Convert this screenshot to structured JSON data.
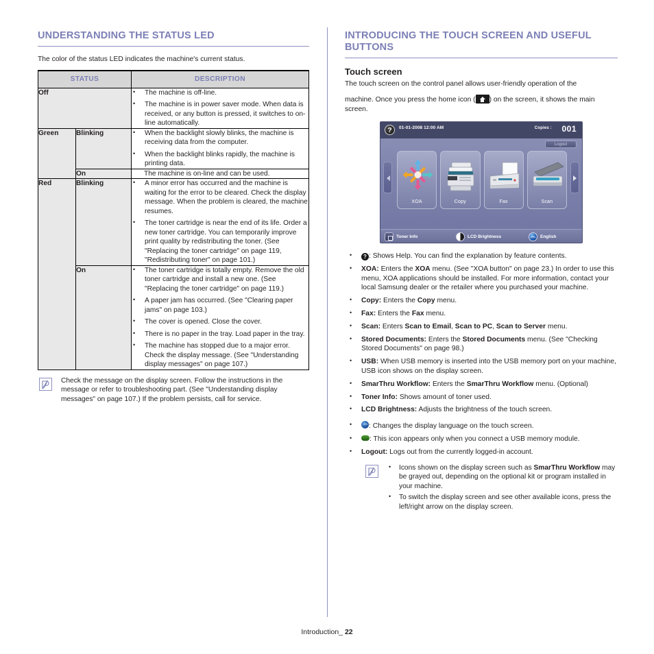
{
  "left": {
    "heading": "UNDERSTANDING THE STATUS LED",
    "intro": "The color of the status LED indicates the machine's current status.",
    "table": {
      "headers": {
        "status": "STATUS",
        "description": "DESCRIPTION"
      },
      "rows": [
        {
          "color": "Off",
          "state": "",
          "items": [
            "The machine is off-line.",
            "The machine is in power saver mode. When data is received, or any button is pressed, it switches to on-line automatically."
          ]
        },
        {
          "color": "Green",
          "state": "Blinking",
          "items": [
            "When the backlight slowly blinks, the machine is receiving data from the computer.",
            "When the backlight blinks rapidly, the machine is printing data."
          ]
        },
        {
          "color": "",
          "state": "On",
          "plain": "The machine is on-line and can be used."
        },
        {
          "color": "Red",
          "state": "Blinking",
          "items": [
            "A minor error has occurred and the machine is waiting for the error to be cleared. Check the display message. When the problem is cleared, the machine resumes.",
            "The toner cartridge is near the end of its life. Order a new toner cartridge. You can temporarily improve print quality by redistributing the toner. (See \"Replacing the toner cartridge\" on page 119, \"Redistributing toner\" on page 101.)"
          ]
        },
        {
          "color": "",
          "state": "On",
          "items": [
            "The toner cartridge is totally empty. Remove the old toner cartridge and install a new one. (See \"Replacing the toner cartridge\" on page 119.)",
            "A paper jam has occurred. (See \"Clearing paper jams\" on page 103.)",
            "The cover is opened. Close the cover.",
            "There is no paper in the tray. Load paper in the tray.",
            "The machine has stopped due to a major error. Check the display message. (See \"Understanding display messages\" on page 107.)"
          ]
        }
      ]
    },
    "note": "Check the message on the display screen. Follow the instructions in the message or refer to troubleshooting part. (See \"Understanding display messages\" on page 107.) If the problem persists, call for service."
  },
  "right": {
    "heading": "INTRODUCING THE TOUCH SCREEN AND USEFUL BUTTONS",
    "sub_heading": "Touch screen",
    "intro_part1": "The touch screen on the control panel allows user-friendly operation of the",
    "intro_part2_pre": "machine. Once you press the home icon (",
    "intro_part2_post": ") on the screen, it shows the main screen.",
    "screen": {
      "datetime": "01-01-2008 12:00 AM",
      "copies_label": "Copies :",
      "copies_value": "001",
      "logout": "Logout",
      "help_glyph": "?",
      "tiles": [
        {
          "label": "XOA",
          "icon": "xoa-icon"
        },
        {
          "label": "Copy",
          "icon": "copy-machine-icon"
        },
        {
          "label": "Fax",
          "icon": "fax-machine-icon"
        },
        {
          "label": "Scan",
          "icon": "scanner-icon"
        }
      ],
      "bottom_bar": [
        {
          "label": "Toner Info",
          "icon": "toner-info-icon"
        },
        {
          "label": "LCD Brightness",
          "icon": "brightness-icon"
        },
        {
          "label": "English",
          "icon": "language-globe-icon"
        }
      ]
    },
    "bullets": [
      {
        "icon": "help-icon",
        "text": ": Shows Help. You can find the explanation by feature contents."
      },
      {
        "term": "XOA:",
        "text": " Enters the |XOA| menu. (See \"XOA button\" on page 23.) In order to use this menu, XOA applications should be installed. For more information, contact your local Samsung dealer or the retailer where you purchased your machine."
      },
      {
        "term": "Copy:",
        "text": " Enters the |Copy| menu."
      },
      {
        "term": "Fax:",
        "text": " Enters the |Fax| menu."
      },
      {
        "term": "Scan:",
        "text": " Enters |Scan to Email|, |Scan to PC|, |Scan to Server| menu."
      },
      {
        "term": "Stored Documents:",
        "text": " Enters the |Stored Documents| menu. (See \"Checking Stored Documents\" on page 98.)"
      },
      {
        "term": "USB:",
        "text": " When USB memory is inserted into the USB memory port on your machine, USB icon shows on the display screen."
      },
      {
        "term": "SmarThru Workflow:",
        "text": " Enters the |SmarThru Workflow| menu. (Optional)"
      },
      {
        "term": "Toner Info:",
        "text": " Shows amount of toner used."
      },
      {
        "term": "LCD Brightness:",
        "text": " Adjusts the brightness of the touch screen."
      },
      {
        "icon": "globe-icon",
        "text": ": Changes the display language on the touch screen."
      },
      {
        "icon": "usb-icon",
        "text": ": This icon appears only when you connect a USB memory module."
      },
      {
        "term": "Logout:",
        "text": " Logs out from the currently logged-in account."
      }
    ],
    "note_items": [
      "Icons shown on the display screen such as |SmarThru Workflow| may be grayed out, depending on the optional kit or program installed in your machine.",
      "To switch the display screen and see other available icons, press the left/right arrow on the display screen."
    ]
  },
  "footer": {
    "label": "Introduction_",
    "page": "22"
  },
  "colors": {
    "heading": "#7b7fb5",
    "rule": "#8d90c0",
    "table_header_bg": "#d6d6d6",
    "table_cell_bg": "#e8e8e8",
    "text": "#231f20"
  }
}
